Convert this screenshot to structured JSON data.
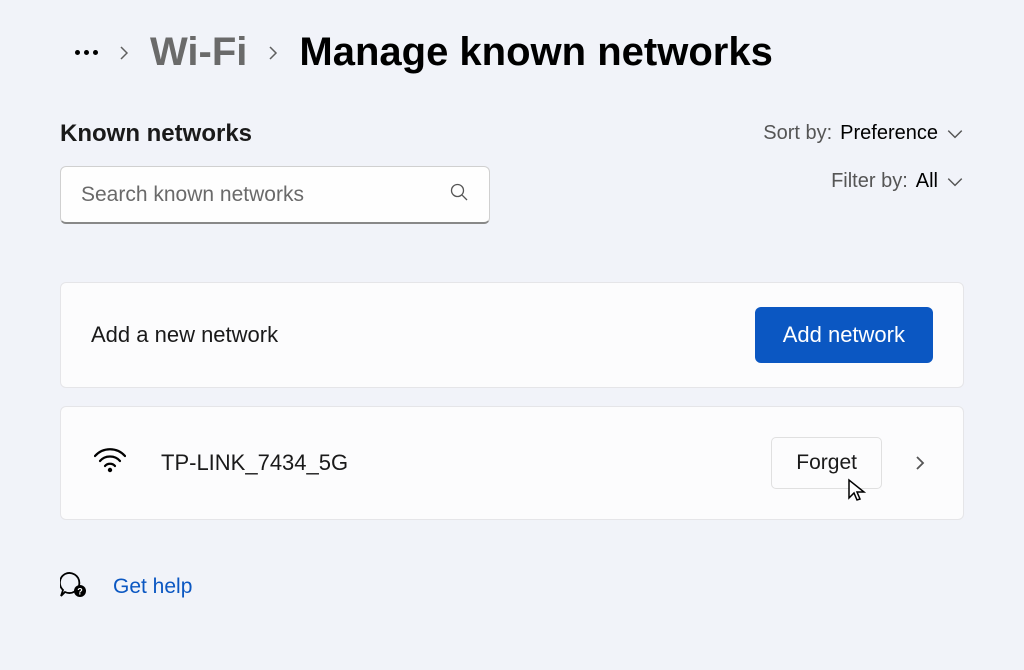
{
  "breadcrumb": {
    "parent": "Wi-Fi",
    "current": "Manage known networks"
  },
  "section": {
    "title": "Known networks",
    "search_placeholder": "Search known networks"
  },
  "sort": {
    "label": "Sort by:",
    "value": "Preference"
  },
  "filter": {
    "label": "Filter by:",
    "value": "All"
  },
  "add_network": {
    "label": "Add a new network",
    "button": "Add network"
  },
  "networks": [
    {
      "name": "TP-LINK_7434_5G",
      "forget_label": "Forget"
    }
  ],
  "help": {
    "label": "Get help"
  }
}
